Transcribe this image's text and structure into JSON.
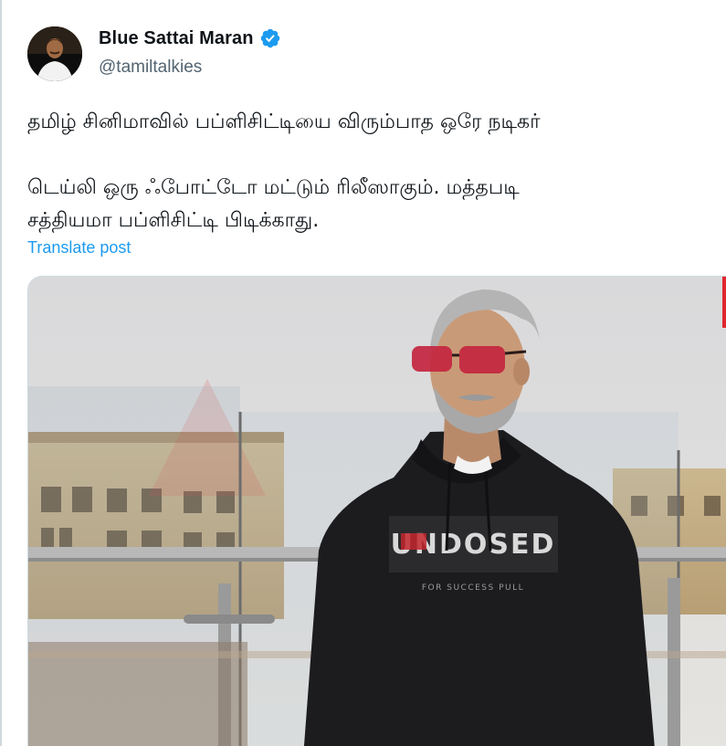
{
  "author": {
    "display_name": "Blue Sattai Maran",
    "handle": "@tamiltalkies",
    "verified": true
  },
  "tweet": {
    "lines": [
      "தமிழ் சினிமாவில் பப்ளிசிட்டியை விரும்பாத ஒரே நடிகர்",
      "டெய்லி ஒரு ஃபோட்டோ மட்டும் ரிலீஸாகும். மத்தபடி",
      "சத்தியமா பப்ளிசிட்டி பிடிக்காது."
    ],
    "translate_label": "Translate post"
  },
  "media": {
    "hoodie_print": "UNDOSED",
    "hoodie_subprint": "FOR SUCCESS PULL"
  },
  "colors": {
    "accent": "#1d9bf0",
    "text": "#0f1419",
    "secondary": "#536471",
    "border": "#cfd9de"
  }
}
